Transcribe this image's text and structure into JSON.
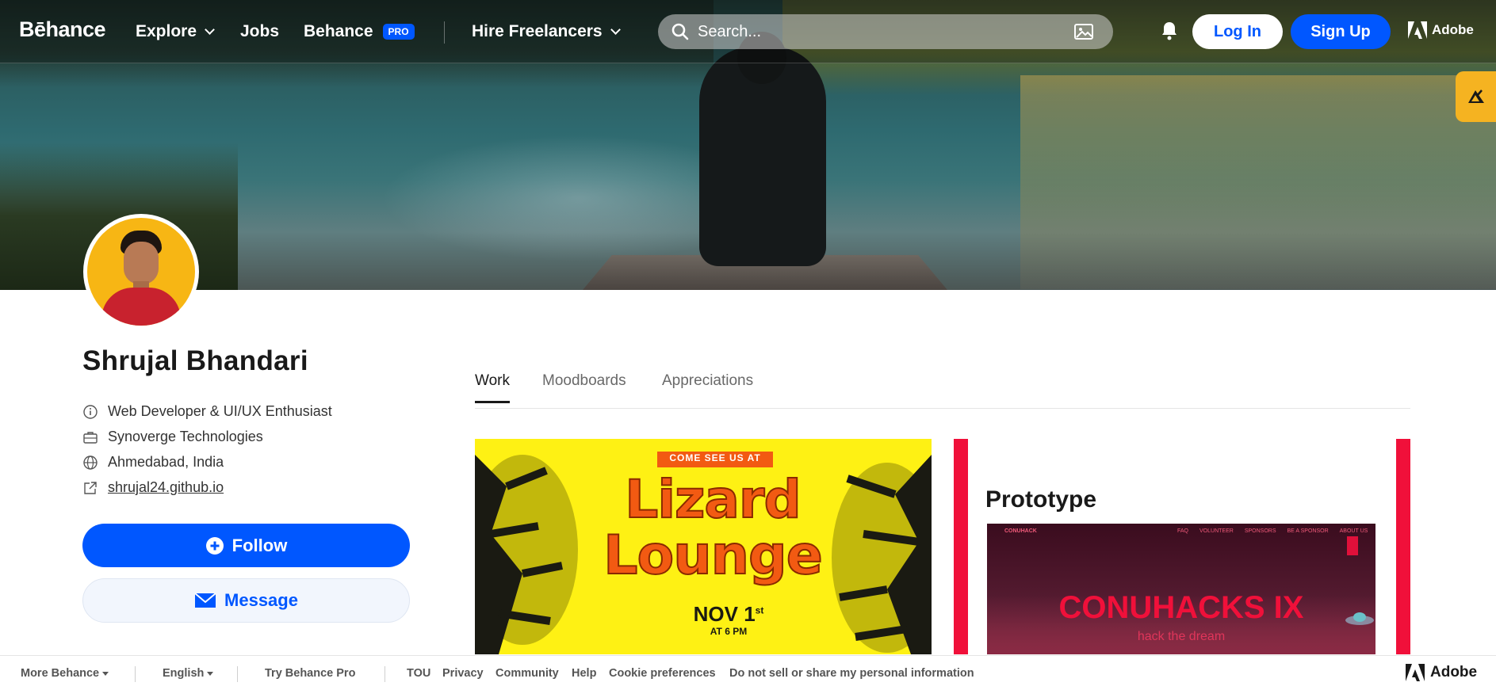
{
  "nav": {
    "logo": "Bēhance",
    "explore": "Explore",
    "jobs": "Jobs",
    "behance": "Behance",
    "pro_badge": "PRO",
    "hire": "Hire Freelancers",
    "search_placeholder": "Search...",
    "login": "Log In",
    "signup": "Sign Up",
    "adobe": "Adobe"
  },
  "profile": {
    "name": "Shrujal Bhandari",
    "occupation": "Web Developer & UI/UX Enthusiast",
    "company": "Synoverge Technologies",
    "location": "Ahmedabad, India",
    "website": "shrujal24.github.io",
    "follow": "Follow",
    "message": "Message"
  },
  "tabs": [
    "Work",
    "Moodboards",
    "Appreciations"
  ],
  "projects": {
    "card1": {
      "banner": "COME SEE US AT",
      "title1": "Lizard",
      "title2": "Lounge",
      "date": "NOV 1",
      "date_sup": "st",
      "time": "AT 6 PM"
    },
    "card2": {
      "title": "Prototype",
      "brand": "CONUHACK",
      "nav": [
        "FAQ",
        "VOLUNTEER",
        "SPONSORS",
        "BE A SPONSOR",
        "ABOUT US"
      ],
      "headline": "CONUHACKS IX",
      "tagline": "hack the dream"
    }
  },
  "footer": {
    "more": "More Behance",
    "language": "English",
    "try_pro": "Try Behance Pro",
    "tou": "TOU",
    "privacy": "Privacy",
    "community": "Community",
    "help": "Help",
    "cookie": "Cookie preferences",
    "donotsell": "Do not sell or share my personal information",
    "adobe": "Adobe"
  },
  "colors": {
    "accent": "#0057ff",
    "lizard_bg": "#fef114",
    "lizard_text": "#f25a12",
    "conu_red": "#f0103a"
  },
  "icons": [
    "search-icon",
    "image-search-icon",
    "bell-icon",
    "adobe-logo",
    "info-icon",
    "briefcase-icon",
    "globe-icon",
    "external-link-icon",
    "plus-circle-icon",
    "mail-icon"
  ]
}
